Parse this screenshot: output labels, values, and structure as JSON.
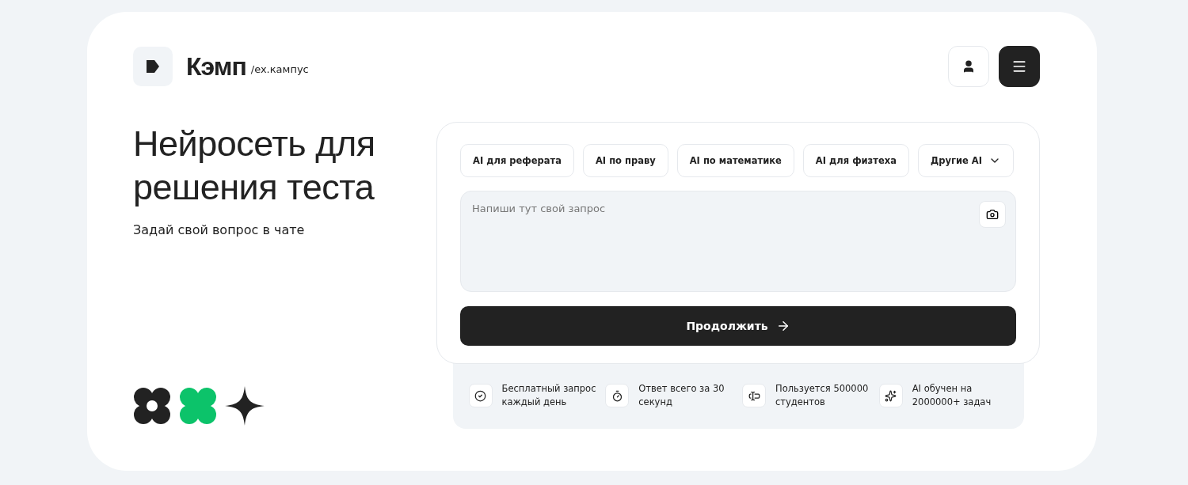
{
  "brand": {
    "name": "Кэмп",
    "suffix": "/ex.кампус"
  },
  "hero": {
    "title": "Нейросеть для решения теста",
    "subtitle": "Задай свой вопрос в чате"
  },
  "chips": [
    {
      "label": "AI для реферата",
      "kind": "chip"
    },
    {
      "label": "AI по праву",
      "kind": "chip"
    },
    {
      "label": "AI по математике",
      "kind": "chip"
    },
    {
      "label": "AI для физтеха",
      "kind": "chip"
    },
    {
      "label": "Другие AI",
      "kind": "dropdown"
    }
  ],
  "query": {
    "placeholder": "Напиши тут свой запрос"
  },
  "submit": {
    "label": "Продолжить"
  },
  "features": [
    {
      "text": "Бесплатный запрос каждый день",
      "kind": "check"
    },
    {
      "text": "Ответ всего за 30 секунд",
      "kind": "timer"
    },
    {
      "text": "Пользуется 500000 студентов",
      "kind": "users"
    },
    {
      "text": "AI обучен на 2000000+ задач",
      "kind": "sparkle"
    }
  ]
}
